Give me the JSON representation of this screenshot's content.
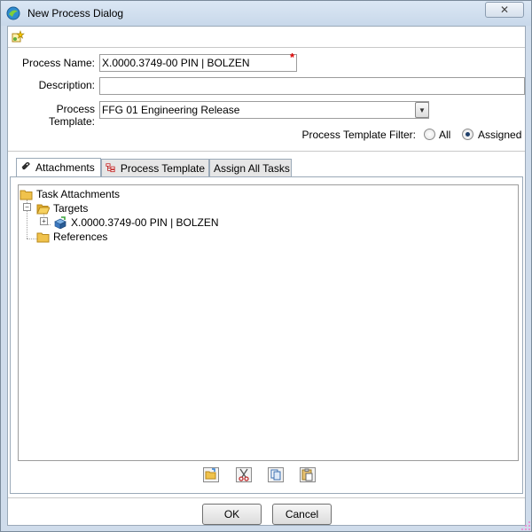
{
  "window": {
    "title": "New Process Dialog",
    "close_glyph": "✕"
  },
  "form": {
    "process_name_label": "Process Name:",
    "process_name_value": "X.0000.3749-00 PIN | BOLZEN",
    "required_marker": "*",
    "description_label": "Description:",
    "description_value": "",
    "process_template_label": "Process Template:",
    "process_template_value": "FFG 01 Engineering Release",
    "filter_label": "Process Template Filter:",
    "filter_options": [
      {
        "label": "All",
        "selected": false
      },
      {
        "label": "Assigned",
        "selected": true
      }
    ]
  },
  "tabs": [
    {
      "label": "Attachments",
      "icon": "paperclip-icon",
      "active": true
    },
    {
      "label": "Process Template",
      "icon": "process-tree-icon",
      "active": false
    },
    {
      "label": "Assign All Tasks",
      "icon": "",
      "active": false
    }
  ],
  "tree": {
    "root": "Task Attachments",
    "targets_label": "Targets",
    "target_item": "X.0000.3749-00 PIN | BOLZEN",
    "references_label": "References"
  },
  "attachment_tools": [
    {
      "icon": "open-folder-icon"
    },
    {
      "icon": "cut-icon"
    },
    {
      "icon": "copy-icon"
    },
    {
      "icon": "paste-icon"
    }
  ],
  "buttons": {
    "ok_label": "OK",
    "cancel_label": "Cancel"
  },
  "colors": {
    "frame": "#cfdceb",
    "folder": "#f0c24c",
    "required": "#e00000"
  }
}
